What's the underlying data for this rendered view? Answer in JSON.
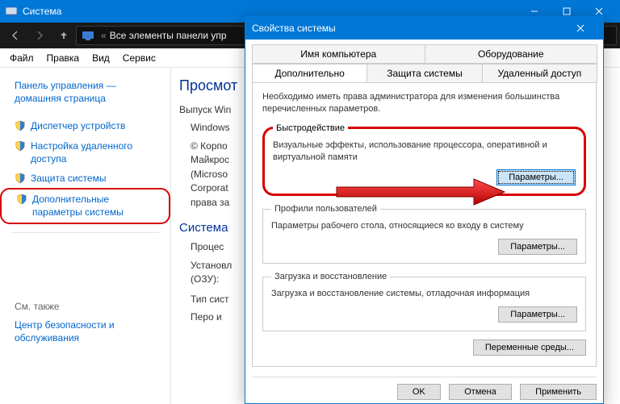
{
  "parent": {
    "title": "Система",
    "breadcrumb": "Все элементы панели упр",
    "menus": {
      "file": "Файл",
      "edit": "Правка",
      "view": "Вид",
      "tools": "Сервис"
    }
  },
  "sidebar": {
    "items": [
      {
        "label": "Панель управления — домашняя страница",
        "shield": false
      },
      {
        "label": "Диспетчер устройств",
        "shield": true
      },
      {
        "label": "Настройка удаленного доступа",
        "shield": true
      },
      {
        "label": "Защита системы",
        "shield": true
      },
      {
        "label": "Дополнительные параметры системы",
        "shield": true,
        "highlighted": true
      }
    ],
    "related_head": "См. также",
    "related": "Центр безопасности и обслуживания"
  },
  "main": {
    "heading": "Просмот",
    "rows": {
      "edition_label": "Выпуск Win",
      "windows": "Windows",
      "copyright": "© Корпо\nМайкрос\n(Microso\nCorporat\nправа за",
      "system_head": "Система",
      "processor": "Процес",
      "ram": "Установл\n(ОЗУ):",
      "systype": "Тип сист",
      "pen": "Перо и"
    }
  },
  "dialog": {
    "title": "Свойства системы",
    "tabs_row1": {
      "computer_name": "Имя компьютера",
      "hardware": "Оборудование"
    },
    "tabs_row2": {
      "advanced": "Дополнительно",
      "protection": "Защита системы",
      "remote": "Удаленный доступ"
    },
    "note": "Необходимо иметь права администратора для изменения большинства перечисленных параметров.",
    "performance": {
      "legend": "Быстродействие",
      "desc": "Визуальные эффекты, использование процессора, оперативной и виртуальной памяти",
      "button": "Параметры..."
    },
    "profiles": {
      "legend": "Профили пользователей",
      "desc": "Параметры рабочего стола, относящиеся ко входу в систему",
      "button": "Параметры..."
    },
    "startup": {
      "legend": "Загрузка и восстановление",
      "desc": "Загрузка и восстановление системы, отладочная информация",
      "button": "Параметры..."
    },
    "env_button": "Переменные среды...",
    "footer": {
      "ok": "OK",
      "cancel": "Отмена",
      "apply": "Применить"
    }
  }
}
